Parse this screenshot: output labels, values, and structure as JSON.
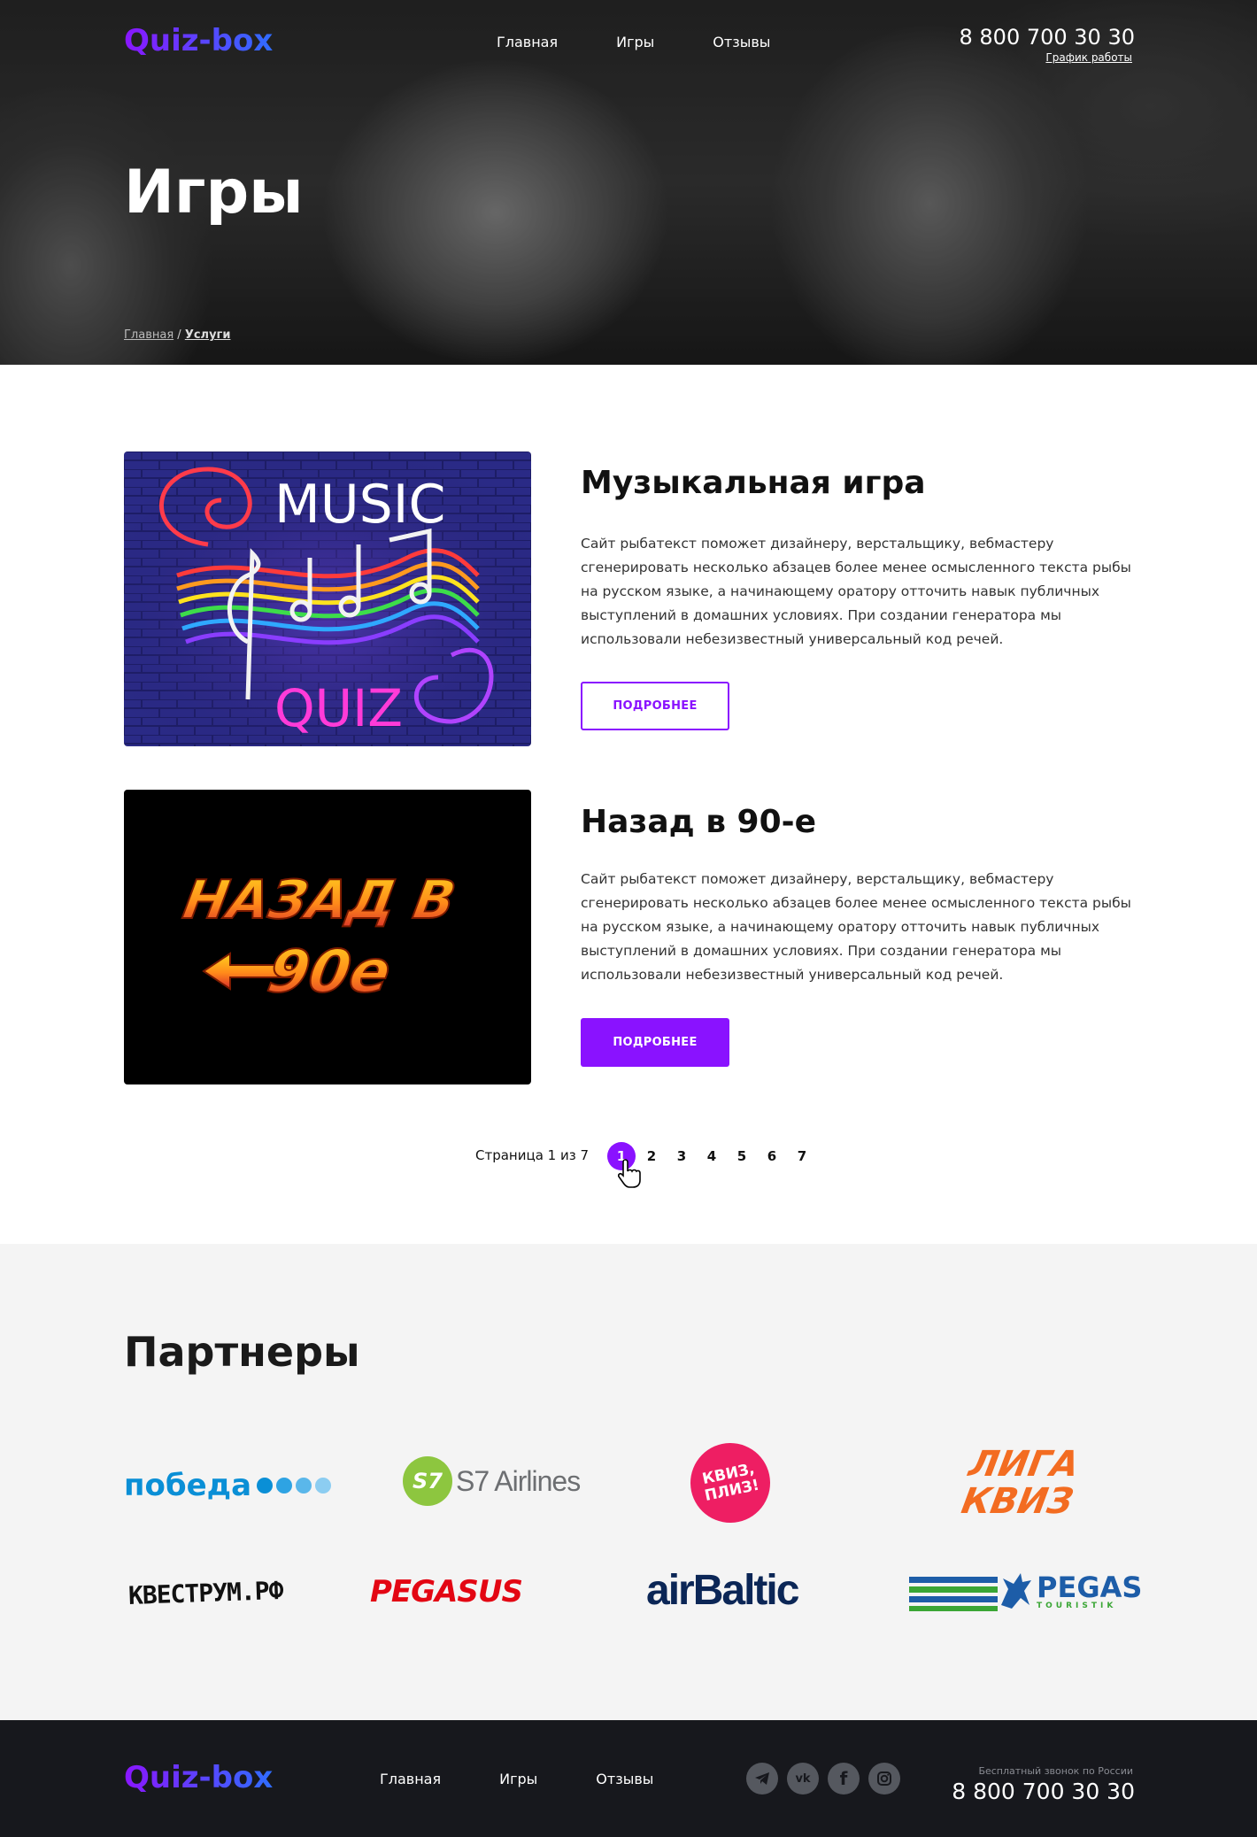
{
  "header": {
    "logo": "Quiz-box",
    "nav": [
      "Главная",
      "Игры",
      "Отзывы"
    ],
    "phone": "8 800 700 30 30",
    "phone_sub": "График работы"
  },
  "hero": {
    "title": "Игры",
    "breadcrumb": {
      "home": "Главная",
      "sep": " / ",
      "current": "Услуги"
    }
  },
  "games": [
    {
      "title": "Музыкальная игра",
      "description": "Сайт рыбатекст поможет дизайнеру, верстальщику, вебмастеру сгенерировать несколько абзацев более менее осмысленного текста рыбы на русском языке, а начинающему оратору отточить навык публичных выступлений в домашних условиях. При создании генератора мы использовали небезизвестный универсальный код речей.",
      "button": "ПОДРОБНЕЕ",
      "image_text": {
        "top": "MUSIC",
        "bottom": "QUIZ"
      }
    },
    {
      "title": "Назад в 90-е",
      "description": "Сайт рыбатекст поможет дизайнеру, верстальщику, вебмастеру сгенерировать несколько абзацев более менее осмысленного текста рыбы на русском языке, а начинающему оратору отточить навык публичных выступлений в домашних условиях. При создании генератора мы использовали небезизвестный универсальный код речей.",
      "button": "ПОДРОБНЕЕ",
      "image_text": {
        "line1": "НАЗАД В",
        "line2": "90е"
      }
    }
  ],
  "pagination": {
    "label": "Страница 1 из 7",
    "pages": [
      "1",
      "2",
      "3",
      "4",
      "5",
      "6",
      "7"
    ],
    "current": 1
  },
  "partners": {
    "title": "Партнеры",
    "logos": [
      {
        "name": "победа",
        "color": "#0a8fd6"
      },
      {
        "name": "S7 Airlines",
        "color": "#8dc63f"
      },
      {
        "name": "КВИЗ, ПЛИЗ!",
        "color": "#ee1e63"
      },
      {
        "name": "ЛИГА КВИЗ",
        "color": "#f36c21"
      },
      {
        "name": "КВЕСТРУМ.РФ",
        "color": "#111111"
      },
      {
        "name": "PEGASUS",
        "color": "#e30613"
      },
      {
        "name": "airBaltic",
        "color": "#0b2656"
      },
      {
        "name": "PEGAS",
        "sub": "TOURISTIK",
        "color": "#1d5da8"
      }
    ]
  },
  "footer": {
    "logo": "Quiz-box",
    "nav": [
      "Главная",
      "Игры",
      "Отзывы"
    ],
    "social_icons": [
      "telegram-icon",
      "vk-icon",
      "facebook-icon",
      "instagram-icon"
    ],
    "phone_caption": "Бесплатный звонок по России",
    "phone": "8 800 700 30 30"
  },
  "colors": {
    "accent": "#8a12ff",
    "footer_bg": "#17181d",
    "partners_bg": "#f4f4f4"
  }
}
